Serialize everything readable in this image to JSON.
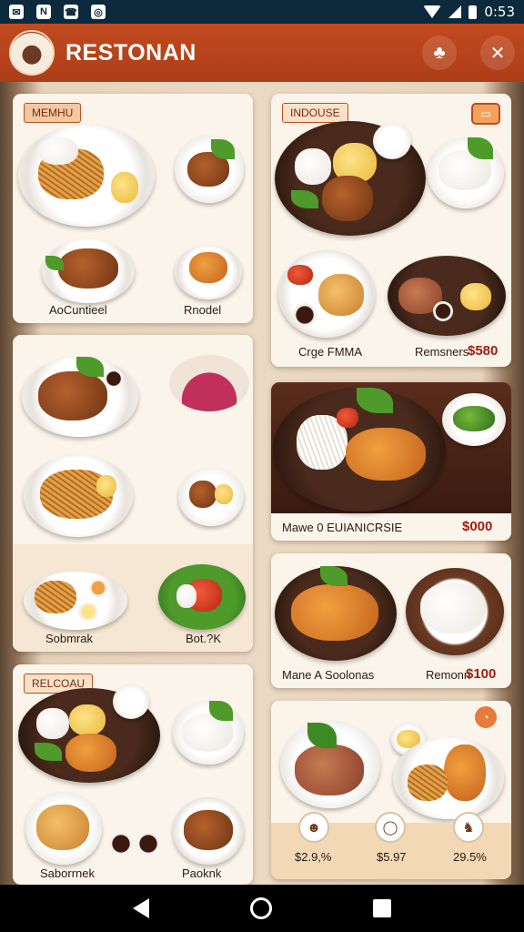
{
  "status_bar": {
    "time": "0:53",
    "left_icons": [
      "app-icon-1",
      "app-icon-2",
      "app-icon-3",
      "app-icon-4"
    ]
  },
  "header": {
    "title": "RESTONAN"
  },
  "cards": {
    "menu": {
      "tag": "MEMHU",
      "label_left": "AoCuntieel",
      "label_right": "Rnodel"
    },
    "indouse": {
      "tag": "INDOUSE",
      "label": "Crge FMMA",
      "label_right": "Remsners",
      "price": "$580"
    },
    "middle_left": {
      "label_left": "Sobmrak",
      "label_right": "Bot.?K"
    },
    "featured": {
      "label": "Mawe 0 EUIANICRSIE",
      "price": "$000"
    },
    "bottom_left": {
      "tag": "RELCOAU",
      "label_left": "Saborrnek",
      "label_right": "Paoknk"
    },
    "right_third": {
      "label": "Mane A Soolonas",
      "label_right": "Remonn",
      "price": "$100"
    },
    "right_fourth": {
      "prices": [
        "$2.9,%",
        "$5.97",
        "29.5%"
      ]
    }
  },
  "colors": {
    "header": "#c24a1f",
    "price": "#a11d12",
    "card": "#fbf4ea"
  }
}
